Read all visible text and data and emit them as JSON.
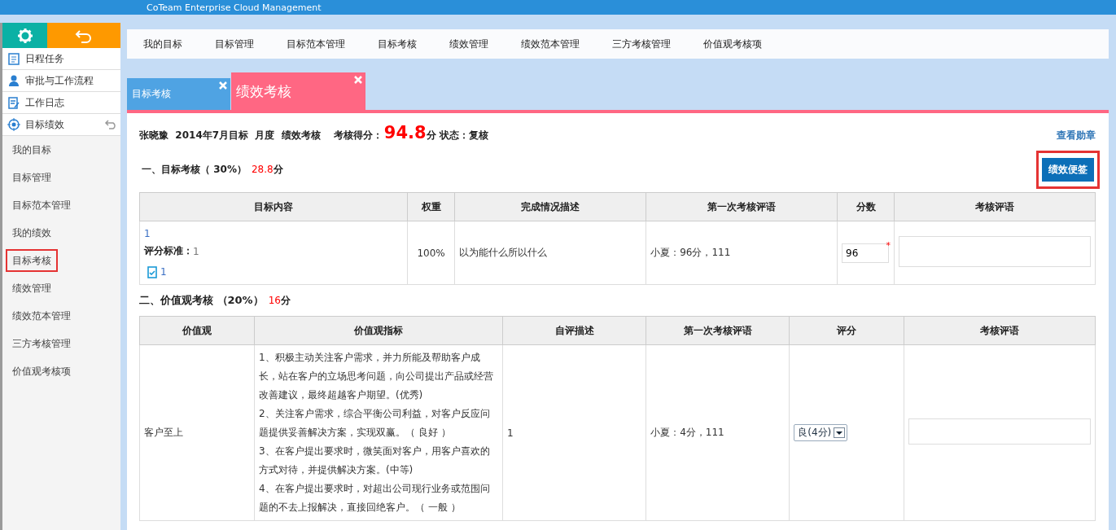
{
  "header": {
    "title": "CoTeam Enterprise Cloud Management"
  },
  "sidebar": {
    "modules": [
      {
        "label": "日程任务",
        "kind": "schedule",
        "expanded": false
      },
      {
        "label": "审批与工作流程",
        "kind": "approval",
        "expanded": false
      },
      {
        "label": "工作日志",
        "kind": "log",
        "expanded": false
      },
      {
        "label": "目标绩效",
        "kind": "target",
        "expanded": true,
        "children": [
          {
            "label": "我的目标",
            "selected": false
          },
          {
            "label": "目标管理",
            "selected": false
          },
          {
            "label": "目标范本管理",
            "selected": false
          },
          {
            "label": "我的绩效",
            "selected": false
          },
          {
            "label": "目标考核",
            "selected": true
          },
          {
            "label": "绩效管理",
            "selected": false
          },
          {
            "label": "绩效范本管理",
            "selected": false
          },
          {
            "label": "三方考核管理",
            "selected": false
          },
          {
            "label": "价值观考核项",
            "selected": false
          }
        ]
      }
    ]
  },
  "nav": [
    "我的目标",
    "目标管理",
    "目标范本管理",
    "目标考核",
    "绩效管理",
    "绩效范本管理",
    "三方考核管理",
    "价值观考核项"
  ],
  "tabs": [
    {
      "label": "目标考核",
      "selected": false
    },
    {
      "label": "绩效考核",
      "selected": true
    }
  ],
  "summary": {
    "info": "张晓豫  2014年7月目标  月度  绩效考核",
    "score_label": "考核得分：",
    "score": "94.8",
    "score_unit": "分 状态：复核",
    "link": "查看勋章"
  },
  "section1": {
    "title": "一、目标考核（ 30%）",
    "score": "28.8",
    "unit": "分",
    "button": "绩效便签",
    "columns": [
      "目标内容",
      "权重",
      "完成情况描述",
      "第一次考核评语",
      "分数",
      "考核评语"
    ],
    "rows": [
      {
        "target": "1",
        "criteria_label": "评分标准：",
        "criteria": "1",
        "attachment": "1",
        "weight": "100%",
        "description": "以为能什么所以什么",
        "first_comment": "小夏：96分，111",
        "score": "96",
        "required_mark": "*"
      }
    ]
  },
  "section2": {
    "title": "二、价值观考核 （20%）",
    "score": "16",
    "unit": "分",
    "columns": [
      "价值观",
      "价值观指标",
      "自评描述",
      "第一次考核评语",
      "评分",
      "考核评语"
    ],
    "rows": [
      {
        "value": "客户至上",
        "indicators": [
          "1、积极主动关注客户需求，并力所能及帮助客户成长，站在客户的立场思考问题，向公司提出产品或经营改善建议，最终超越客户期望。(优秀)",
          "2、关注客户需求，综合平衡公司利益，对客户反应问题提供妥善解决方案，实现双赢。（ 良好 ）",
          "3、在客户提出要求时，微笑面对客户，用客户喜欢的方式对待，并提供解决方案。(中等)",
          "4、在客户提出要求时，对超出公司现行业务或范围问题的不去上报解决，直接回绝客户。（ 一般 ）"
        ],
        "self": "1",
        "first_comment": "小夏：4分，111",
        "rating": "良(4分)"
      }
    ]
  }
}
